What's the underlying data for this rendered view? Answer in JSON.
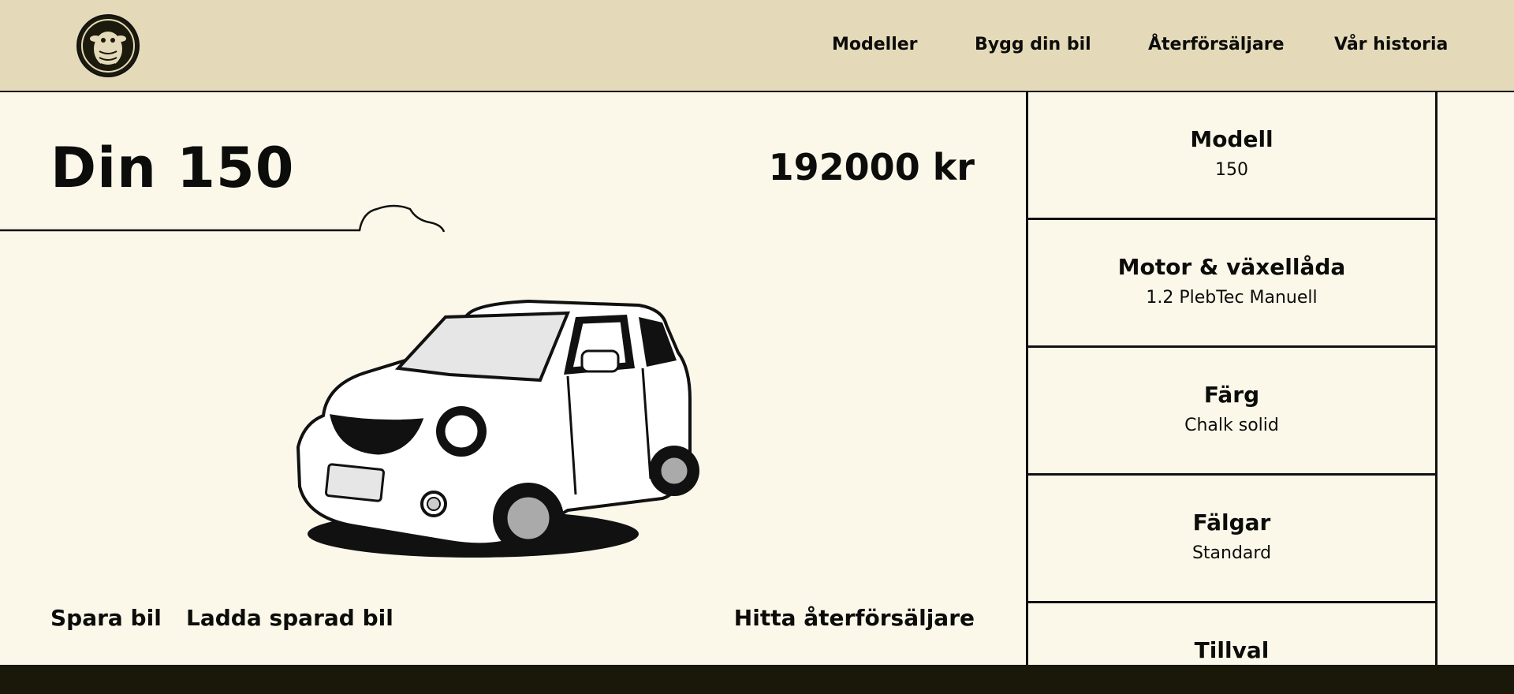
{
  "header": {
    "logo_icon": "sheep-logo-icon",
    "nav": [
      "Modeller",
      "Bygg din bil",
      "Återförsäljare",
      "Vår historia"
    ]
  },
  "main": {
    "title": "Din 150",
    "price": "192000 kr",
    "car_image": "white-hatchback-car-illustration",
    "actions": {
      "save": "Spara bil",
      "load": "Ladda sparad bil",
      "dealer": "Hitta återförsäljare"
    }
  },
  "specs": [
    {
      "label": "Modell",
      "value": "150"
    },
    {
      "label": "Motor & växellåda",
      "value": "1.2 PlebTec Manuell"
    },
    {
      "label": "Färg",
      "value": "Chalk solid"
    },
    {
      "label": "Fälgar",
      "value": "Standard"
    },
    {
      "label": "Tillval",
      "value": ""
    }
  ],
  "colors": {
    "header_bg": "#e4dab9",
    "page_bg": "#fbf8ea",
    "footer_bg": "#1a1809",
    "text": "#0c0c0a"
  }
}
